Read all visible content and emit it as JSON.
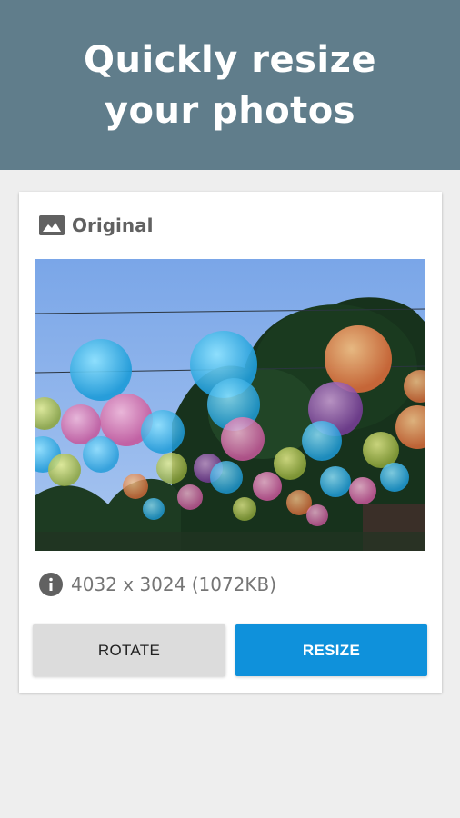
{
  "banner": {
    "title": "Quickly resize your photos",
    "background": "#607d8b"
  },
  "card": {
    "header_icon": "image-icon",
    "header_title": "Original",
    "photo_alt": "colorful balloons photo",
    "info_icon": "info-icon",
    "info_text": "4032 x 3024 (1072KB)",
    "buttons": {
      "rotate_label": "ROTATE",
      "resize_label": "RESIZE"
    },
    "accent_color": "#0f91db"
  }
}
